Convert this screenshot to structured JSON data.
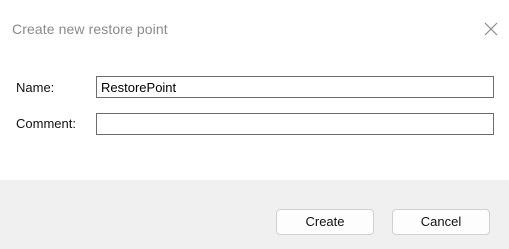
{
  "dialog": {
    "title": "Create new restore point",
    "close_icon": "close-icon"
  },
  "form": {
    "name_label": "Name:",
    "name_value": "RestorePoint",
    "comment_label": "Comment:",
    "comment_value": ""
  },
  "footer": {
    "create_label": "Create",
    "cancel_label": "Cancel"
  }
}
